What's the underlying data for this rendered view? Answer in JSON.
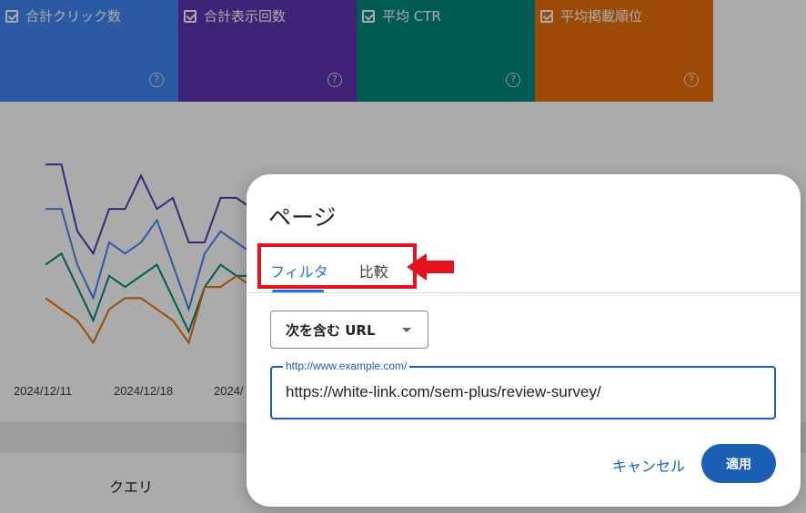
{
  "metrics": [
    {
      "label": "合計クリック数",
      "color": "#4285f4"
    },
    {
      "label": "合計表示回数",
      "color": "#5e35b1"
    },
    {
      "label": "平均 CTR",
      "color": "#00897b"
    },
    {
      "label": "平均掲載順位",
      "color": "#e8710a"
    }
  ],
  "help_glyph": "?",
  "chart_data": {
    "type": "line",
    "x_tick_labels": [
      "2024/12/11",
      "2024/12/18",
      "2024/"
    ],
    "series": [
      {
        "color": "#5e35b1",
        "values": [
          10,
          10,
          4,
          2,
          6,
          6,
          9,
          6,
          7,
          3,
          3,
          7,
          7,
          6,
          5
        ]
      },
      {
        "color": "#4285f4",
        "values": [
          6,
          6,
          1,
          -2,
          3,
          2,
          3,
          5,
          1,
          -3,
          2,
          4,
          3,
          2,
          2
        ]
      },
      {
        "color": "#00897b",
        "values": [
          1,
          2,
          -1,
          -4,
          0,
          -1,
          0,
          1,
          -2,
          -5,
          -1,
          1,
          0,
          0,
          0
        ]
      },
      {
        "color": "#e8710a",
        "values": [
          -2,
          -3,
          -4,
          -6,
          -3,
          -2,
          -2,
          -3,
          -4,
          -6,
          -1,
          -1,
          0,
          -1,
          -1
        ]
      }
    ]
  },
  "bottom": {
    "query_header": "クエリ"
  },
  "dialog": {
    "title": "ページ",
    "tabs": [
      {
        "label": "フィルタ"
      },
      {
        "label": "比較"
      }
    ],
    "select": {
      "value": "次を含む URL"
    },
    "url_field": {
      "label": "http://www.example.com/",
      "value": "https://white-link.com/sem-plus/review-survey/"
    },
    "cancel_label": "キャンセル",
    "apply_label": "適用"
  },
  "colors": {
    "accent": "#1a73e8",
    "highlight": "#e5111c"
  }
}
